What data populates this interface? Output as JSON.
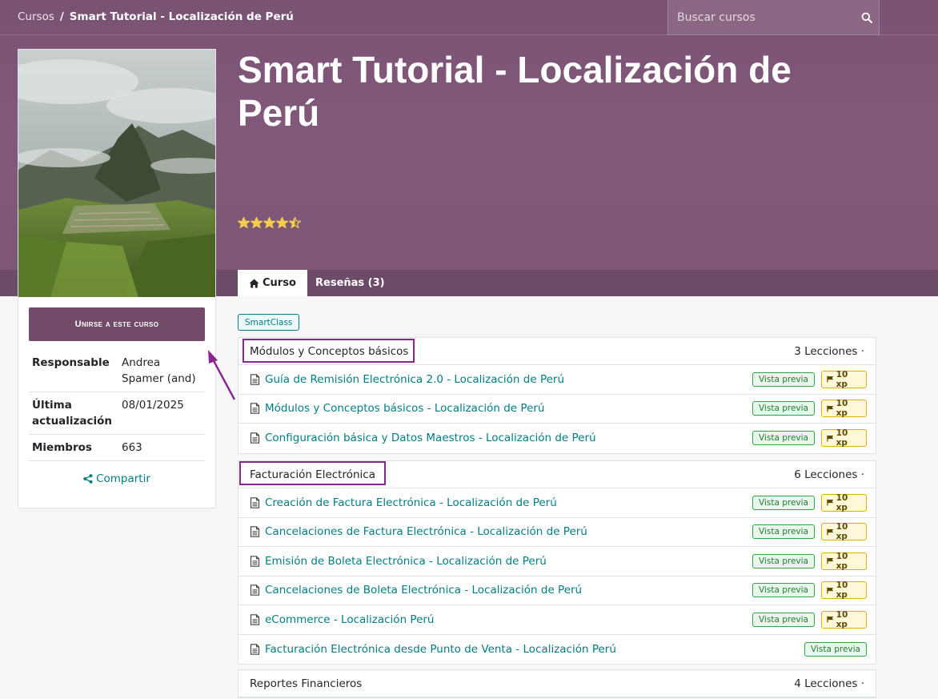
{
  "breadcrumb": {
    "root": "Cursos",
    "separator": "/",
    "current": "Smart Tutorial - Localización de Perú"
  },
  "search": {
    "placeholder": "Buscar cursos"
  },
  "course": {
    "title": "Smart Tutorial - Localización de Perú",
    "rating": 4.5,
    "rating_max": 5
  },
  "tabs": [
    {
      "label": "Curso"
    },
    {
      "label": "Reseñas (3)"
    }
  ],
  "sidebar": {
    "join_label": "Unirse a este curso",
    "info": [
      {
        "label": "Responsable",
        "value": "Andrea Spamer (and)"
      },
      {
        "label": "Última actualización",
        "value": "08/01/2025"
      },
      {
        "label": "Miembros",
        "value": "663"
      }
    ],
    "share_label": "Compartir"
  },
  "tag": "SmartClass",
  "sections": [
    {
      "title": "Módulos y Conceptos básicos",
      "count": "3 Lecciones ·",
      "lessons": [
        {
          "title": "Guía de Remisión Electrónica 2.0 - Localización de Perú",
          "preview": "Vista previa",
          "xp": "10 xp"
        },
        {
          "title": "Módulos y Conceptos básicos - Localización de Perú",
          "preview": "Vista previa",
          "xp": "10 xp"
        },
        {
          "title": "Configuración básica y Datos Maestros - Localización de Perú",
          "preview": "Vista previa",
          "xp": "10 xp"
        }
      ]
    },
    {
      "title": "Facturación Electrónica",
      "count": "6 Lecciones ·",
      "lessons": [
        {
          "title": "Creación de Factura Electrónica - Localización de Perú",
          "preview": "Vista previa",
          "xp": "10 xp"
        },
        {
          "title": "Cancelaciones de Factura Electrónica - Localización de Perú",
          "preview": "Vista previa",
          "xp": "10 xp"
        },
        {
          "title": "Emisión de Boleta Electrónica - Localización de Perú",
          "preview": "Vista previa",
          "xp": "10 xp"
        },
        {
          "title": "Cancelaciones de Boleta Electrónica - Localización de Perú",
          "preview": "Vista previa",
          "xp": "10 xp"
        },
        {
          "title": "eCommerce - Localización Perú",
          "preview": "Vista previa",
          "xp": "10 xp"
        },
        {
          "title": "Facturación Electrónica desde Punto de Venta - Localización Perú",
          "preview": "Vista previa"
        }
      ]
    },
    {
      "title": "Reportes Financieros",
      "count": "4 Lecciones ·",
      "lessons": []
    }
  ],
  "colors": {
    "brand": "#714b67",
    "link": "#017e84",
    "annotation": "#8a2490",
    "star": "#f3cc4f"
  },
  "icons": {
    "search": "search-icon",
    "home": "home-icon",
    "share": "share-icon",
    "document": "document-icon",
    "flag": "flag-icon",
    "star": "star-icon"
  }
}
